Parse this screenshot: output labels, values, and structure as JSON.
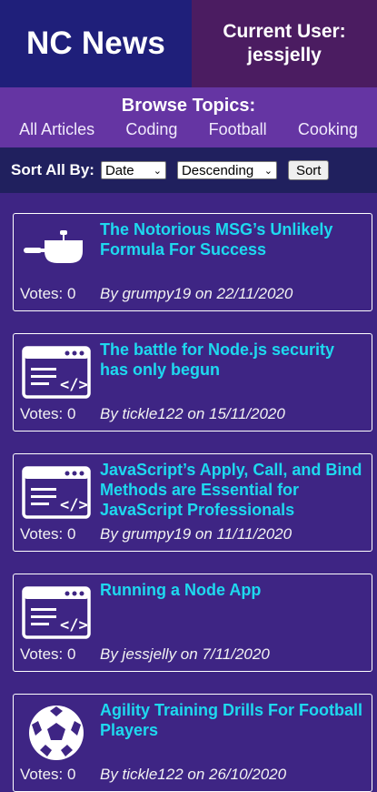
{
  "header": {
    "brand": "NC News",
    "user_label": "Current User:",
    "username": "jessjelly"
  },
  "topics": {
    "title": "Browse Topics:",
    "links": [
      "All Articles",
      "Coding",
      "Football",
      "Cooking"
    ]
  },
  "sort": {
    "label": "Sort All By:",
    "field_value": "Date",
    "order_value": "Descending",
    "button_label": "Sort"
  },
  "articles": [
    {
      "title": "The Notorious MSG’s Unlikely Formula For Success",
      "votes": "Votes: 0",
      "byline": "By grumpy19 on 22/11/2020",
      "icon": "cooking-pan-icon"
    },
    {
      "title": "The battle for Node.js security has only begun",
      "votes": "Votes: 0",
      "byline": "By tickle122 on 15/11/2020",
      "icon": "code-window-icon"
    },
    {
      "title": "JavaScript’s Apply, Call, and Bind Methods are Essential for JavaScript Professionals",
      "votes": "Votes: 0",
      "byline": "By grumpy19 on 11/11/2020",
      "icon": "code-window-icon"
    },
    {
      "title": "Running a Node App",
      "votes": "Votes: 0",
      "byline": "By jessjelly on 7/11/2020",
      "icon": "code-window-icon"
    },
    {
      "title": "Agility Training Drills For Football Players",
      "votes": "Votes: 0",
      "byline": "By tickle122 on 26/10/2020",
      "icon": "football-icon"
    }
  ]
}
